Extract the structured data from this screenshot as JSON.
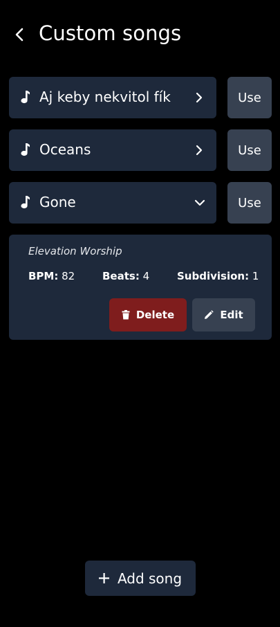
{
  "header": {
    "title": "Custom songs",
    "back_icon": "chevron-left-icon"
  },
  "songs": [
    {
      "name": "Aj keby nekvitol fík",
      "use_label": "Use",
      "expanded": false
    },
    {
      "name": "Oceans",
      "use_label": "Use",
      "expanded": false
    },
    {
      "name": "Gone",
      "use_label": "Use",
      "expanded": true
    }
  ],
  "details": {
    "artist": "Elevation Worship",
    "bpm_label": "BPM:",
    "bpm_value": "82",
    "beats_label": "Beats:",
    "beats_value": "4",
    "subdivision_label": "Subdivision:",
    "subdivision_value": "1",
    "delete_label": "Delete",
    "edit_label": "Edit"
  },
  "add_song_label": "Add song",
  "colors": {
    "background": "#000000",
    "card": "#1e293b",
    "use_button": "#374151",
    "delete_button": "#7f1d1d"
  }
}
